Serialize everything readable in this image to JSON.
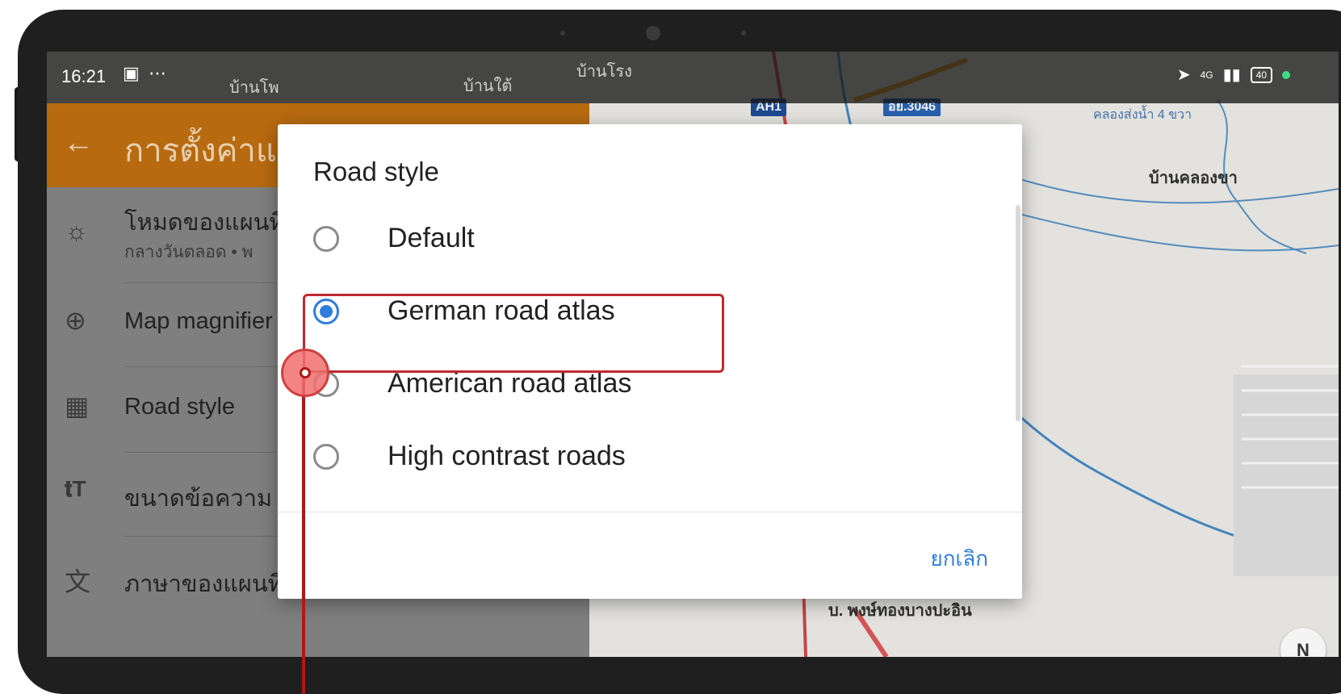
{
  "status_bar": {
    "time": "16:21",
    "notif_icons": "⋯",
    "network": "4G",
    "battery": "40"
  },
  "map": {
    "labels": [
      "บ้านโพ",
      "บ้านใต้",
      "บ้านโรง",
      "บ้านคลองขา",
      "คลองส่งน้ำ 4 ขวา",
      "บ. พงษ์ทองบางปะอิน"
    ],
    "shields": [
      {
        "text": "AH1",
        "color": "#1f4f9a"
      },
      {
        "text": "อย.3046",
        "color": "#2a66b8"
      }
    ],
    "compass": "N"
  },
  "settings": {
    "title": "การตั้งค่าแ",
    "items": [
      {
        "icon": "sun-icon",
        "label": "โหมดของแผนที่",
        "sub": "กลางวันตลอด • พ"
      },
      {
        "icon": "zoom-in-icon",
        "label": "Map magnifier",
        "sub": ""
      },
      {
        "icon": "road-icon",
        "label": "Road style",
        "sub": ""
      },
      {
        "icon": "text-size-icon",
        "label": "ขนาดข้อความ",
        "sub": ""
      },
      {
        "icon": "translate-icon",
        "label": "ภาษาของแผนที่",
        "sub": ""
      }
    ]
  },
  "dialog": {
    "title": "Road style",
    "options": [
      {
        "label": "Default",
        "checked": false
      },
      {
        "label": "German road atlas",
        "checked": true
      },
      {
        "label": "American road atlas",
        "checked": false
      },
      {
        "label": "High contrast roads",
        "checked": false
      }
    ],
    "cancel_label": "ยกเลิก"
  },
  "colors": {
    "accent": "#2f7de1",
    "header": "#b86a10",
    "annotation": "#c0282e"
  }
}
